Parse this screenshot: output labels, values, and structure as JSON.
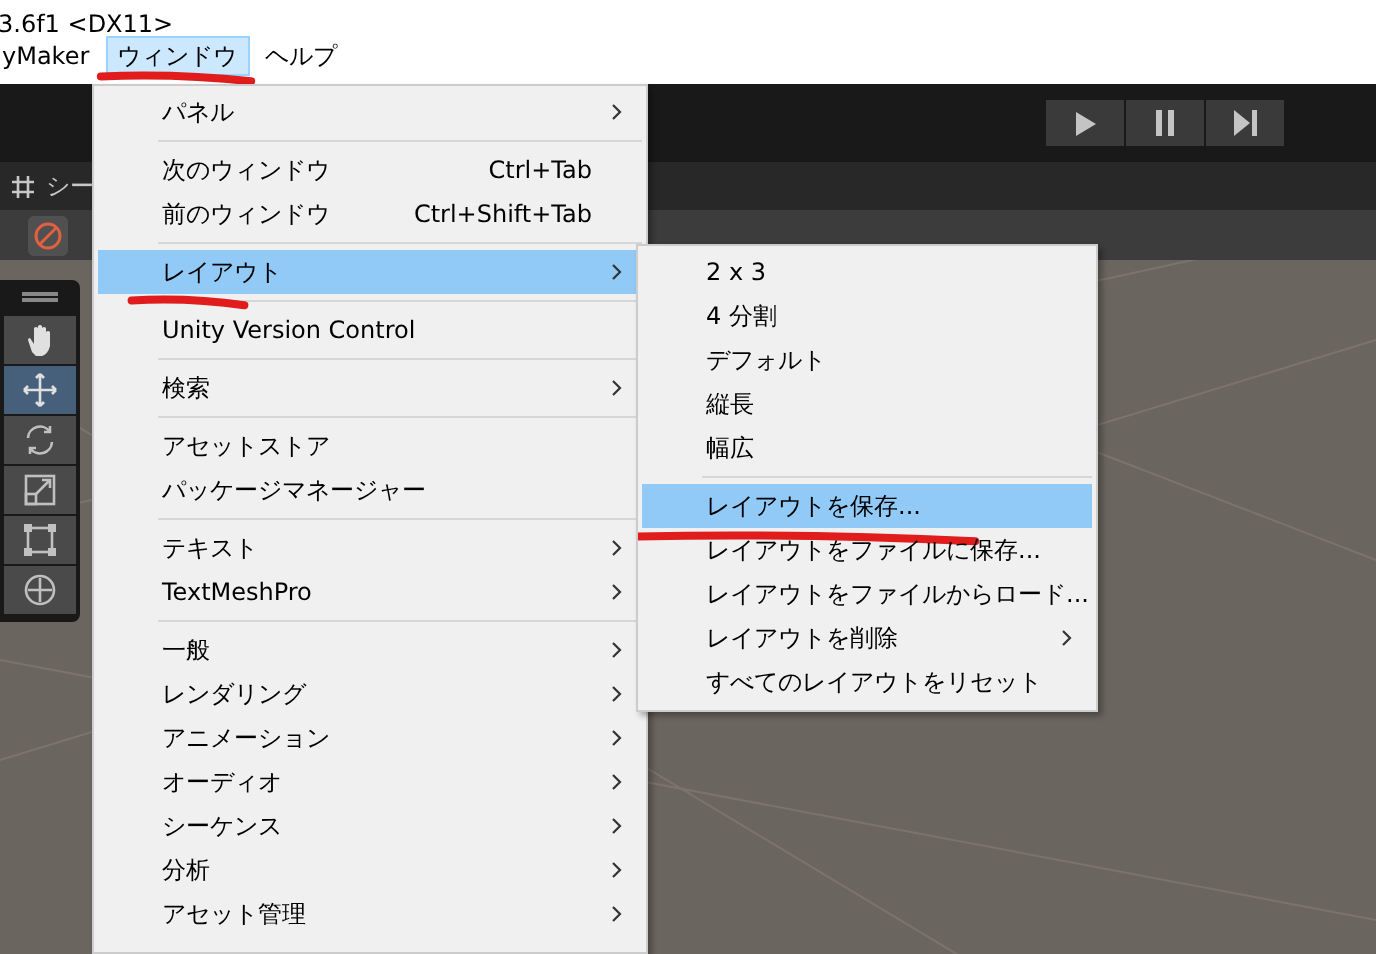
{
  "title_bar": {
    "text": "3.6f1 <DX11>"
  },
  "menu_bar": [
    {
      "label": "yMaker",
      "selected": false,
      "marked": false
    },
    {
      "label": "ウィンドウ",
      "selected": true,
      "marked": true
    },
    {
      "label": "ヘルプ",
      "selected": false,
      "marked": false
    }
  ],
  "scene_tab": {
    "label": "シー"
  },
  "tools": [
    {
      "kind": "hand",
      "selected": false
    },
    {
      "kind": "move",
      "selected": true
    },
    {
      "kind": "rotate",
      "selected": false
    },
    {
      "kind": "scale",
      "selected": false
    },
    {
      "kind": "rect",
      "selected": false
    },
    {
      "kind": "transform",
      "selected": false
    }
  ],
  "window_menu": [
    {
      "kind": "item",
      "label": "パネル",
      "submenu": true,
      "selected": false,
      "marked": false
    },
    {
      "kind": "separator"
    },
    {
      "kind": "item",
      "label": "次のウィンドウ",
      "shortcut": "Ctrl+Tab",
      "submenu": false,
      "selected": false,
      "marked": false
    },
    {
      "kind": "item",
      "label": "前のウィンドウ",
      "shortcut": "Ctrl+Shift+Tab",
      "submenu": false,
      "selected": false,
      "marked": false
    },
    {
      "kind": "separator"
    },
    {
      "kind": "item",
      "label": "レイアウト",
      "submenu": true,
      "selected": true,
      "marked": true
    },
    {
      "kind": "separator"
    },
    {
      "kind": "item",
      "label": "Unity Version Control",
      "submenu": false,
      "selected": false,
      "marked": false
    },
    {
      "kind": "separator"
    },
    {
      "kind": "item",
      "label": "検索",
      "submenu": true,
      "selected": false,
      "marked": false
    },
    {
      "kind": "separator"
    },
    {
      "kind": "item",
      "label": "アセットストア",
      "submenu": false,
      "selected": false,
      "marked": false
    },
    {
      "kind": "item",
      "label": "パッケージマネージャー",
      "submenu": false,
      "selected": false,
      "marked": false
    },
    {
      "kind": "separator"
    },
    {
      "kind": "item",
      "label": "テキスト",
      "submenu": true,
      "selected": false,
      "marked": false
    },
    {
      "kind": "item",
      "label": "TextMeshPro",
      "submenu": true,
      "selected": false,
      "marked": false
    },
    {
      "kind": "separator"
    },
    {
      "kind": "item",
      "label": "一般",
      "submenu": true,
      "selected": false,
      "marked": false
    },
    {
      "kind": "item",
      "label": "レンダリング",
      "submenu": true,
      "selected": false,
      "marked": false
    },
    {
      "kind": "item",
      "label": "アニメーション",
      "submenu": true,
      "selected": false,
      "marked": false
    },
    {
      "kind": "item",
      "label": "オーディオ",
      "submenu": true,
      "selected": false,
      "marked": false
    },
    {
      "kind": "item",
      "label": "シーケンス",
      "submenu": true,
      "selected": false,
      "marked": false
    },
    {
      "kind": "item",
      "label": "分析",
      "submenu": true,
      "selected": false,
      "marked": false
    },
    {
      "kind": "item",
      "label": "アセット管理",
      "submenu": true,
      "selected": false,
      "marked": false
    }
  ],
  "layout_submenu": [
    {
      "kind": "item",
      "label": "2 x 3",
      "submenu": false,
      "selected": false,
      "marked": false
    },
    {
      "kind": "item",
      "label": "4 分割",
      "submenu": false,
      "selected": false,
      "marked": false
    },
    {
      "kind": "item",
      "label": "デフォルト",
      "submenu": false,
      "selected": false,
      "marked": false
    },
    {
      "kind": "item",
      "label": "縦長",
      "submenu": false,
      "selected": false,
      "marked": false
    },
    {
      "kind": "item",
      "label": "幅広",
      "submenu": false,
      "selected": false,
      "marked": false
    },
    {
      "kind": "separator"
    },
    {
      "kind": "item",
      "label": "レイアウトを保存...",
      "submenu": false,
      "selected": true,
      "marked": true
    },
    {
      "kind": "item",
      "label": "レイアウトをファイルに保存...",
      "submenu": false,
      "selected": false,
      "marked": false
    },
    {
      "kind": "item",
      "label": "レイアウトをファイルからロード...",
      "submenu": false,
      "selected": false,
      "marked": false
    },
    {
      "kind": "item",
      "label": "レイアウトを削除",
      "submenu": true,
      "selected": false,
      "marked": false
    },
    {
      "kind": "item",
      "label": "すべてのレイアウトをリセット",
      "submenu": false,
      "selected": false,
      "marked": false
    }
  ]
}
